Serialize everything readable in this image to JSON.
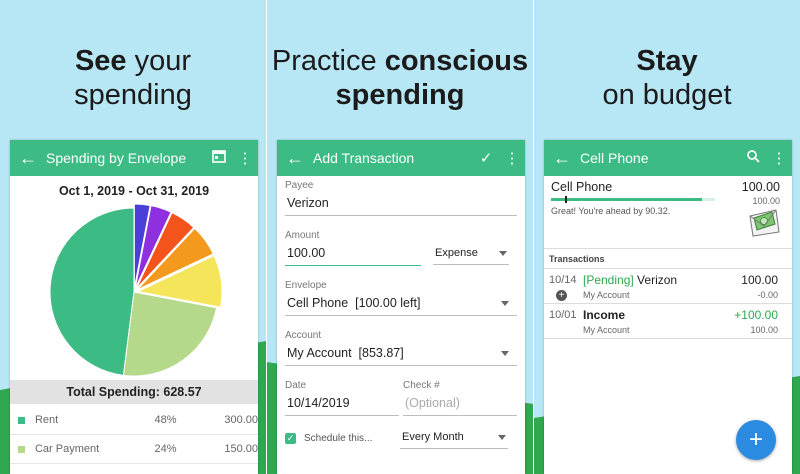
{
  "headlines": {
    "left": {
      "bold": "See",
      "rest_line1": " your",
      "line2": "spending"
    },
    "middle": {
      "line1_plain": "Practice ",
      "line1_bold": "conscious",
      "line2_bold": "spending"
    },
    "right": {
      "line1_bold": "Stay",
      "line2": "on budget"
    }
  },
  "colors": {
    "accent": "#3dbb84",
    "sky": "#b7e6f5",
    "hill": "#2fa84f",
    "fab": "#2a8be0",
    "positive": "#2fa84f"
  },
  "screen1": {
    "title": "Spending by Envelope",
    "date_range": "Oct 1, 2019 - Oct 31, 2019",
    "total": "Total Spending: 628.57",
    "rows": [
      {
        "name": "Rent",
        "pct": "48%",
        "amount": "300.00",
        "color": "#3dbb84"
      },
      {
        "name": "Car Payment",
        "pct": "24%",
        "amount": "150.00",
        "color": "#b5d98a"
      }
    ]
  },
  "chart_data": {
    "type": "pie",
    "title": "",
    "slices": [
      {
        "label": "Rent",
        "value": 48,
        "color": "#3dbb84"
      },
      {
        "label": "Car Payment",
        "value": 24,
        "color": "#b5d98a"
      },
      {
        "label": "Slice 3",
        "value": 10,
        "color": "#f4e55a"
      },
      {
        "label": "Slice 4",
        "value": 6,
        "color": "#f39a1e"
      },
      {
        "label": "Slice 5",
        "value": 5,
        "color": "#f2541b"
      },
      {
        "label": "Slice 6",
        "value": 4,
        "color": "#8e2fe0"
      },
      {
        "label": "Slice 7",
        "value": 3,
        "color": "#4a3fd8"
      }
    ]
  },
  "screen2": {
    "title": "Add Transaction",
    "payee_label": "Payee",
    "payee_value": "Verizon",
    "amount_label": "Amount",
    "amount_value": "100.00",
    "type_value": "Expense",
    "envelope_label": "Envelope",
    "envelope_value": "Cell Phone  [100.00 left]",
    "account_label": "Account",
    "account_value": "My Account  [853.87]",
    "date_label": "Date",
    "date_value": "10/14/2019",
    "check_label": "Check #",
    "check_placeholder": "(Optional)",
    "schedule_label": "Schedule this...",
    "frequency_value": "Every Month"
  },
  "screen3": {
    "title": "Cell Phone",
    "envelope_name": "Cell Phone",
    "envelope_amount": "100.00",
    "budget_amount": "100.00",
    "progress": 0.92,
    "ahead_text": "Great! You're ahead by 90.32.",
    "transactions_header": "Transactions",
    "transactions": [
      {
        "date": "10/14",
        "status": "[Pending]",
        "payee": " Verizon",
        "amount": "100.00",
        "account": "My Account",
        "balance": "-0.00",
        "bold": false,
        "positive": false
      },
      {
        "date": "10/01",
        "status": "",
        "payee": "Income",
        "amount": "+100.00",
        "account": "My Account",
        "balance": "100.00",
        "bold": true,
        "positive": true
      }
    ],
    "fab_label": "+"
  }
}
